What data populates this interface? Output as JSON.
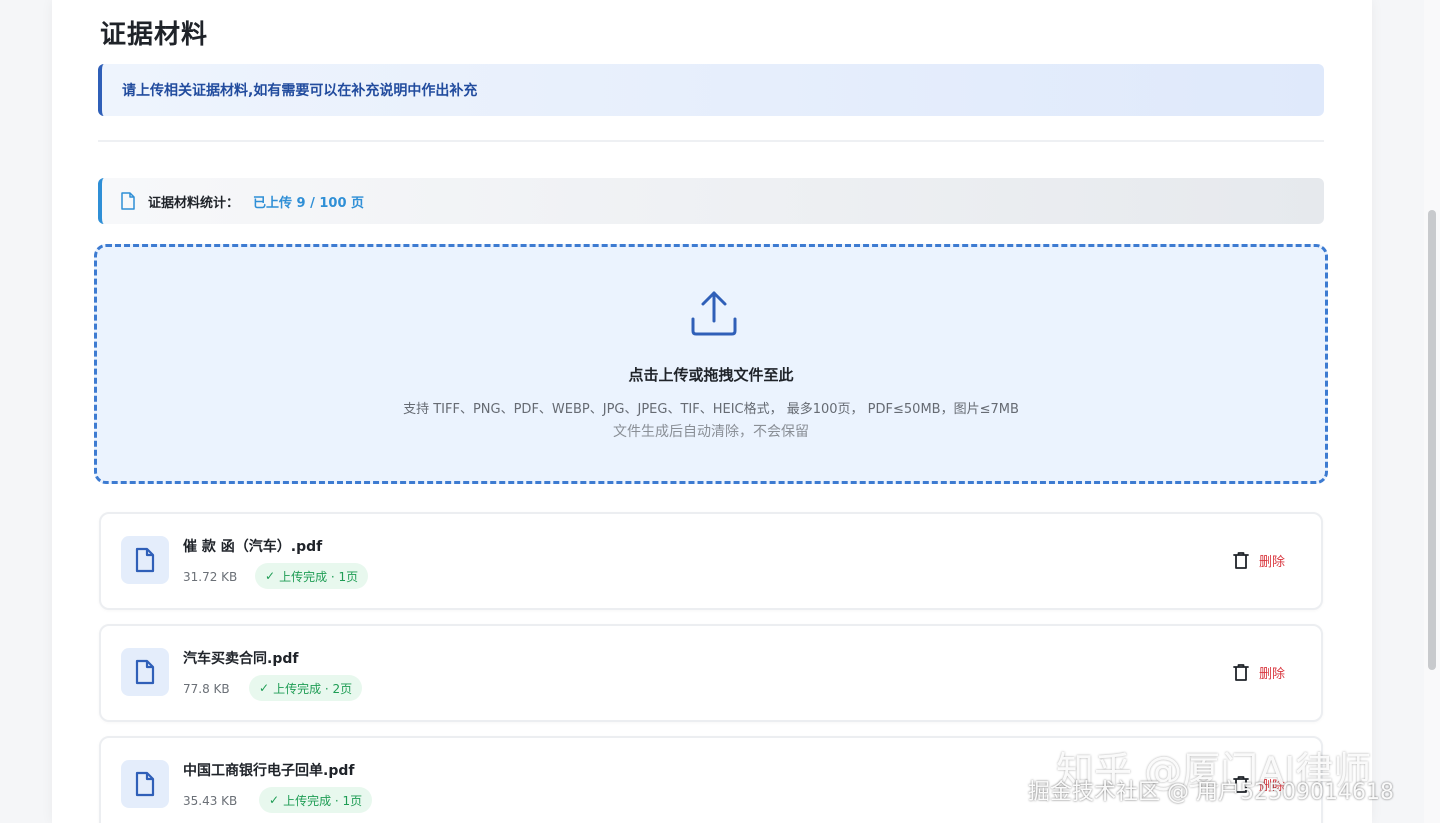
{
  "page": {
    "title": "证据材料",
    "notice": "请上传相关证据材料,如有需要可以在补充说明中作出补充"
  },
  "stats": {
    "label": "证据材料统计：",
    "value": "已上传 9 / 100 页",
    "icon": "document-icon"
  },
  "dropzone": {
    "icon": "upload-icon",
    "title": "点击上传或拖拽文件至此",
    "hint": "支持 TIFF、PNG、PDF、WEBP、JPG、JPEG、TIF、HEIC格式， 最多100页， PDF≤50MB，图片≤7MB",
    "note": "文件生成后自动清除，不会保留"
  },
  "files": [
    {
      "name": "催 款 函（汽车）.pdf",
      "size": "31.72 KB",
      "status": "上传完成 · 1页",
      "delete_label": "删除"
    },
    {
      "name": "汽车买卖合同.pdf",
      "size": "77.8 KB",
      "status": "上传完成 · 2页",
      "delete_label": "删除"
    },
    {
      "name": "中国工商银行电子回单.pdf",
      "size": "35.43 KB",
      "status": "上传完成 · 1页",
      "delete_label": "删除"
    }
  ],
  "watermark": {
    "line1": "知乎 @厦门AI律师",
    "line2": "掘金技术社区 @ 用户52509014618"
  },
  "colors": {
    "accent": "#2f5fb8",
    "stats_accent": "#2f8fd6",
    "success": "#1f9d55",
    "danger": "#d9363e"
  }
}
